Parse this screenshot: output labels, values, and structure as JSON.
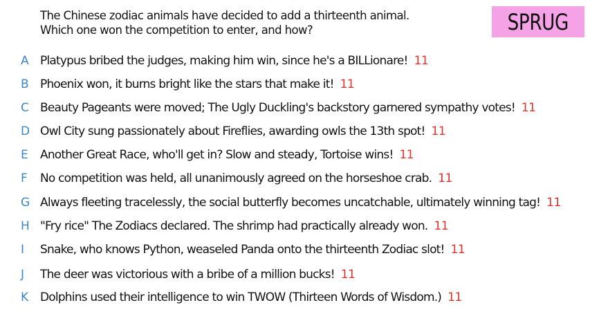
{
  "prompt": {
    "line1": "The Chinese zodiac animals have decided to add a thirteenth animal.",
    "line2": "Which one won the competition to enter, and how?"
  },
  "badge": {
    "label": "SPRUG",
    "color": "#f5a3e6"
  },
  "colors": {
    "letter": "#3a86c8",
    "count": "#e0312b",
    "text": "#111111"
  },
  "responses": [
    {
      "letter": "A",
      "text": "Platypus bribed the judges, making him win, since he's a BILLionare!",
      "count": "11"
    },
    {
      "letter": "B",
      "text": "Phoenix won, it burns bright like the stars that make it!",
      "count": "11"
    },
    {
      "letter": "C",
      "text": "Beauty Pageants were moved; The Ugly Duckling's backstory garnered sympathy votes!",
      "count": "11"
    },
    {
      "letter": "D",
      "text": "Owl City sung passionately about Fireflies, awarding owls the 13th spot!",
      "count": "11"
    },
    {
      "letter": "E",
      "text": "Another Great Race, who'll get in? Slow and steady, Tortoise wins!",
      "count": "11"
    },
    {
      "letter": "F",
      "text": "No competition was held, all unanimously agreed on the horseshoe crab.",
      "count": "11"
    },
    {
      "letter": "G",
      "text": "Always fleeting tracelessly, the social butterfly becomes uncatchable, ultimately winning tag!",
      "count": "11"
    },
    {
      "letter": "H",
      "text": "\"Fry rice\" The Zodiacs declared. The shrimp had practically already won.",
      "count": "11"
    },
    {
      "letter": "I",
      "text": "Snake, who knows Python, weaseled Panda onto the thirteenth Zodiac slot!",
      "count": "11"
    },
    {
      "letter": "J",
      "text": "The deer was victorious with a bribe of a million bucks!",
      "count": "11"
    },
    {
      "letter": "K",
      "text": "Dolphins used their intelligence to win TWOW (Thirteen Words of Wisdom.)",
      "count": "11"
    }
  ]
}
